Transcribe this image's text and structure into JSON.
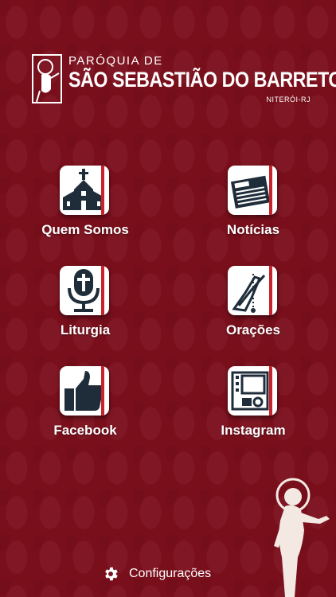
{
  "header": {
    "line1": "PARÓQUIA DE",
    "line2": "SÃO SEBASTIÃO DO BARRETO",
    "line3": "NITERÓI-RJ"
  },
  "menu": [
    {
      "label": "Quem Somos",
      "icon": "church-icon"
    },
    {
      "label": "Notícias",
      "icon": "newspaper-icon"
    },
    {
      "label": "Liturgia",
      "icon": "microphone-cross-icon"
    },
    {
      "label": "Orações",
      "icon": "praying-hands-icon"
    },
    {
      "label": "Facebook",
      "icon": "thumbs-up-icon"
    },
    {
      "label": "Instagram",
      "icon": "film-photo-icon"
    }
  ],
  "footer": {
    "settings_label": "Configurações",
    "settings_icon": "gear-icon"
  },
  "colors": {
    "background": "#7a0f1c",
    "icon_dark": "#1f2d3a",
    "accent": "#c8232c"
  }
}
